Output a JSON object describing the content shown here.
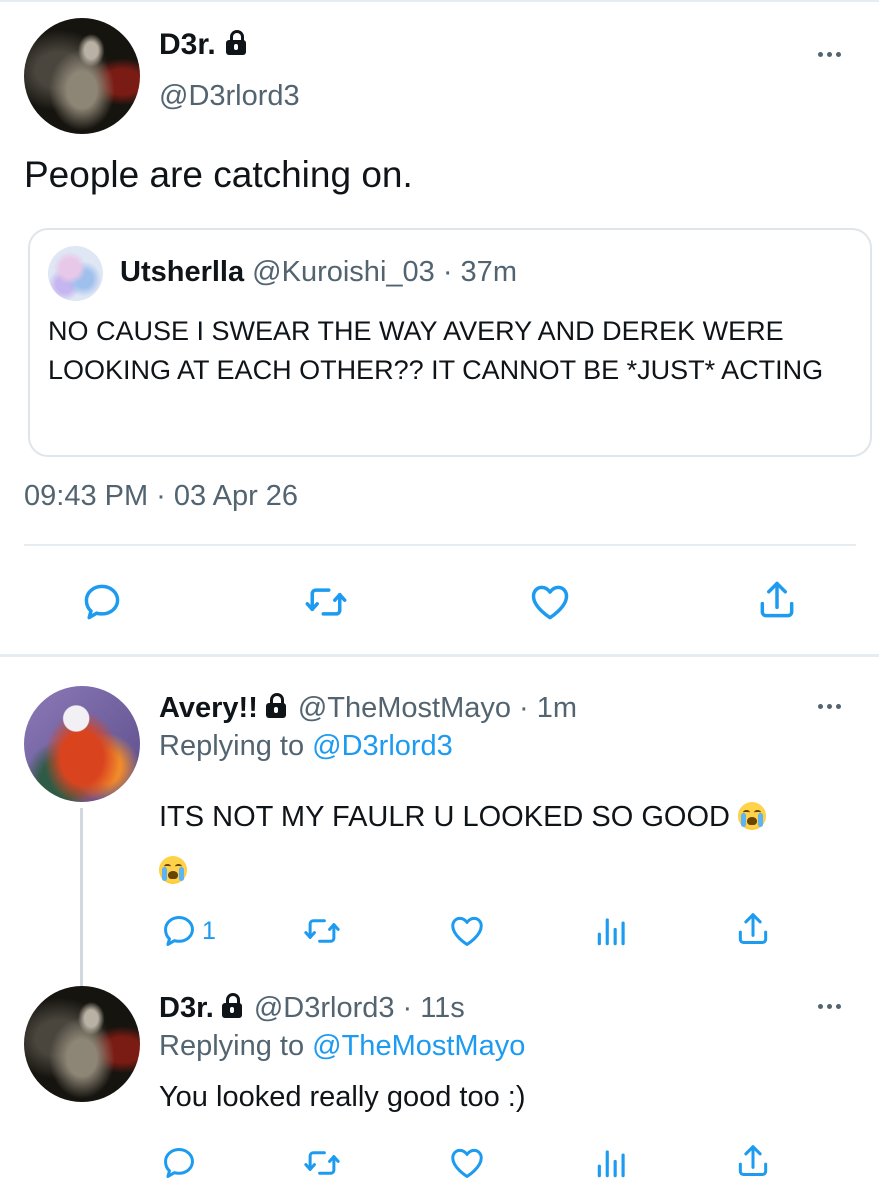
{
  "main_tweet": {
    "display_name": "D3r.",
    "handle": "@D3rlord3",
    "text": "People are catching on.",
    "timestamp": "09:43 PM · 03 Apr 26",
    "quoted": {
      "display_name": "Utsherlla",
      "handle": "@Kuroishi_03",
      "time": "· 37m",
      "text": "NO CAUSE I SWEAR THE WAY AVERY AND DEREK WERE LOOKING AT EACH OTHER?? IT CANNOT BE *JUST* ACTING"
    },
    "actions": [
      "reply-icon",
      "retweet-icon",
      "like-icon",
      "share-icon"
    ]
  },
  "replies": [
    {
      "display_name": "Avery!!",
      "handle": "@TheMostMayo",
      "time": "· 1m",
      "replying_prefix": "Replying to",
      "replying_to": "@D3rlord3",
      "text": "ITS NOT MY FAULR U LOOKED SO GOOD",
      "emoji": "loudly-crying-face",
      "reply_count": "1"
    },
    {
      "display_name": "D3r.",
      "handle": "@D3rlord3",
      "time": "· 11s",
      "replying_prefix": "Replying to",
      "replying_to": "@TheMostMayo",
      "text": "You looked really good too :)"
    }
  ],
  "colors": {
    "text": "#0f1419",
    "secondary": "#536471",
    "link": "#1d9bf0",
    "divider": "#e6ecf0",
    "action_icon": "#1d9bf0"
  }
}
